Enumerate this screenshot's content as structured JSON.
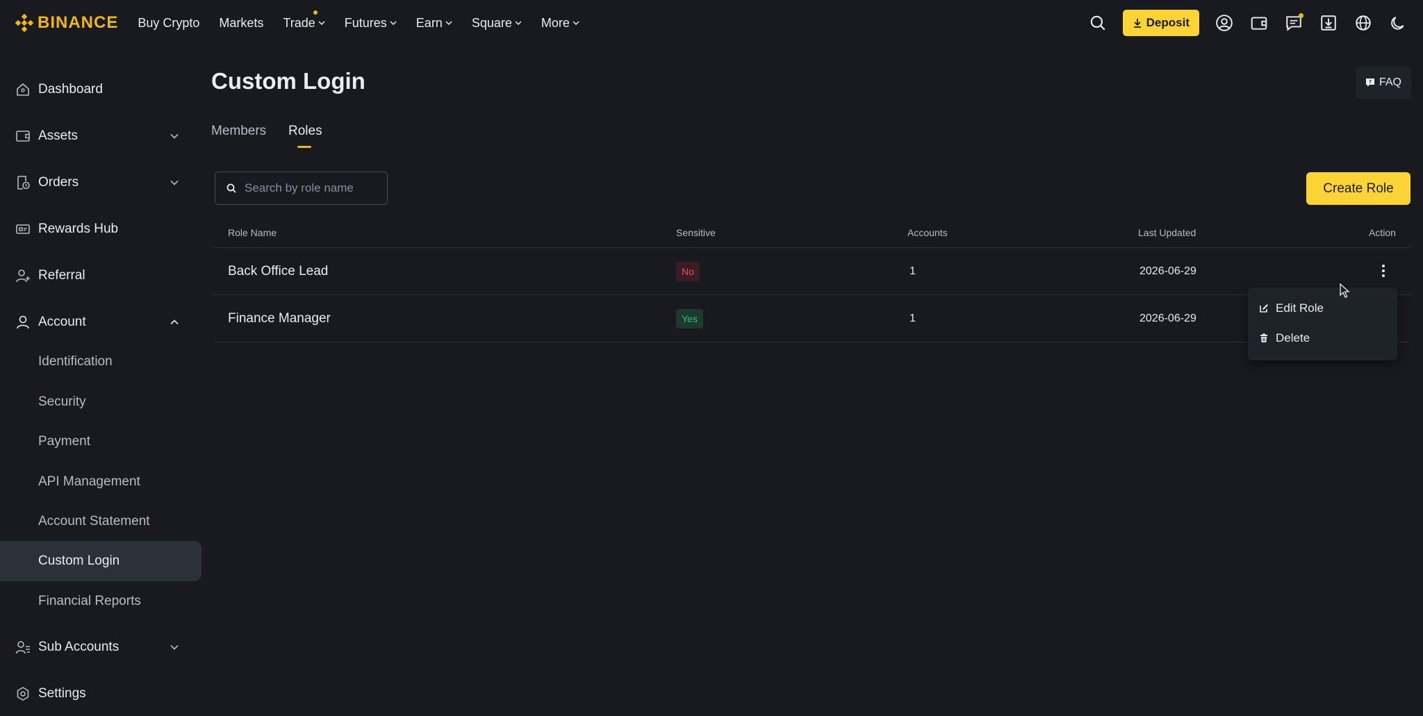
{
  "header": {
    "logo_text": "BINANCE",
    "nav": [
      {
        "label": "Buy Crypto",
        "dropdown": false
      },
      {
        "label": "Markets",
        "dropdown": false
      },
      {
        "label": "Trade",
        "dropdown": true
      },
      {
        "label": "Futures",
        "dropdown": true
      },
      {
        "label": "Earn",
        "dropdown": true
      },
      {
        "label": "Square",
        "dropdown": true
      },
      {
        "label": "More",
        "dropdown": true
      }
    ],
    "deposit_label": "Deposit",
    "icons": [
      "search-icon",
      "profile-icon",
      "wallet-icon",
      "messages-icon",
      "download-icon",
      "globe-icon",
      "moon-icon"
    ]
  },
  "sidebar": {
    "items": [
      {
        "label": "Dashboard",
        "icon": "home-icon"
      },
      {
        "label": "Assets",
        "icon": "wallet-icon"
      },
      {
        "label": "Orders",
        "icon": "orders-icon"
      },
      {
        "label": "Rewards Hub",
        "icon": "ticket-icon"
      },
      {
        "label": "Referral",
        "icon": "user-plus-icon"
      },
      {
        "label": "Account",
        "icon": "user-icon"
      },
      {
        "label": "Sub Accounts",
        "icon": "sub-accounts-icon"
      },
      {
        "label": "Settings",
        "icon": "gear-icon"
      }
    ],
    "account_subitems": [
      "Identification",
      "Security",
      "Payment",
      "API Management",
      "Account Statement",
      "Custom Login",
      "Financial Reports"
    ],
    "active_subitem": "Custom Login"
  },
  "main": {
    "title": "Custom Login",
    "faq_label": "FAQ",
    "tabs": [
      {
        "label": "Members",
        "active": false
      },
      {
        "label": "Roles",
        "active": true
      }
    ],
    "search": {
      "placeholder": "Search by role name",
      "value": ""
    },
    "create_label": "Create Role",
    "table": {
      "headers": [
        "Role Name",
        "Sensitive",
        "Accounts",
        "Last Updated",
        "Action"
      ],
      "rows": [
        {
          "role_name": "Back Office Lead",
          "sensitive": "No",
          "accounts": "1",
          "last_updated": "2026-06-29"
        },
        {
          "role_name": "Finance Manager",
          "sensitive": "Yes",
          "accounts": "1",
          "last_updated": "2026-06-29"
        }
      ]
    },
    "action_menu": {
      "items": [
        {
          "label": "Edit Role",
          "icon": "edit-icon"
        },
        {
          "label": "Delete",
          "icon": "trash-icon"
        }
      ]
    }
  },
  "colors": {
    "background": "#181a20",
    "accent": "#fcd535",
    "panel": "#1e2329",
    "active_row": "#2b3139",
    "negative": "#f6465d",
    "positive": "#2ebd85"
  }
}
